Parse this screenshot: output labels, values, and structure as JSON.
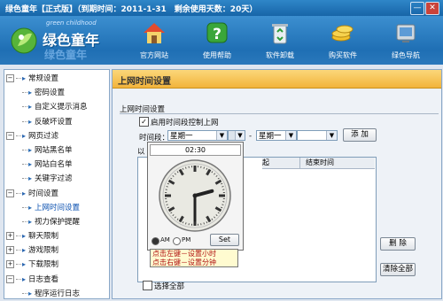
{
  "window": {
    "title": "绿色童年【正式版】（到期时间：2011-1-31　剩余使用天数：20天）",
    "controls": {
      "minimize": "—",
      "close": "✕"
    }
  },
  "brand": {
    "en": "green childhood",
    "cn": "绿色童年",
    "cn_reflection": "绿色童年"
  },
  "toolbar": [
    {
      "label": "官方网站",
      "icon": "home-icon"
    },
    {
      "label": "使用帮助",
      "icon": "help-icon"
    },
    {
      "label": "软件卸载",
      "icon": "recycle-bin-icon"
    },
    {
      "label": "购买软件",
      "icon": "coins-icon"
    },
    {
      "label": "绿色导航",
      "icon": "navigation-icon"
    }
  ],
  "sidebar": {
    "items": [
      {
        "label": "常规设置",
        "level": 0,
        "expander": "−"
      },
      {
        "label": "密码设置",
        "level": 1
      },
      {
        "label": "自定义提示消息",
        "level": 1
      },
      {
        "label": "反破坏设置",
        "level": 1
      },
      {
        "label": "网页过滤",
        "level": 0,
        "expander": "−"
      },
      {
        "label": "网站黑名单",
        "level": 1
      },
      {
        "label": "网站白名单",
        "level": 1
      },
      {
        "label": "关键字过滤",
        "level": 1
      },
      {
        "label": "时间设置",
        "level": 0,
        "expander": "−"
      },
      {
        "label": "上网时间设置",
        "level": 1,
        "selected": true
      },
      {
        "label": "视力保护提醒",
        "level": 1
      },
      {
        "label": "聊天限制",
        "level": 0,
        "expander": "+"
      },
      {
        "label": "游戏限制",
        "level": 0,
        "expander": "+"
      },
      {
        "label": "下载限制",
        "level": 0,
        "expander": "+"
      },
      {
        "label": "日志查看",
        "level": 0,
        "expander": "−"
      },
      {
        "label": "程序运行日志",
        "level": 1
      }
    ]
  },
  "panel": {
    "title": "上网时间设置",
    "group_label": "上网时间设置",
    "enable_checkbox": {
      "label": "启用时间段控制上网",
      "checked": true
    },
    "period_label": "时间段：",
    "start_day": "星期一",
    "end_day": "星期一",
    "separator": "-",
    "add_button": "添 加",
    "list_prefix": "以",
    "list_columns": {
      "start": "起",
      "end": "结束时间"
    },
    "delete_button": "删 除",
    "clear_button": "清除全部",
    "select_all": {
      "label": "选择全部",
      "checked": false
    }
  },
  "clock_popup": {
    "time": "02:30",
    "hour": 2,
    "minute": 30,
    "am_label": "AM",
    "pm_label": "PM",
    "am_selected": true,
    "set_button": "Set",
    "tooltip_line1": "点击左键－设置小时",
    "tooltip_line2": "点击右键－设置分钟"
  },
  "colors": {
    "accent": "#1f6fb4",
    "panel_header": "#f2b43b",
    "tooltip_text": "#b01010"
  }
}
